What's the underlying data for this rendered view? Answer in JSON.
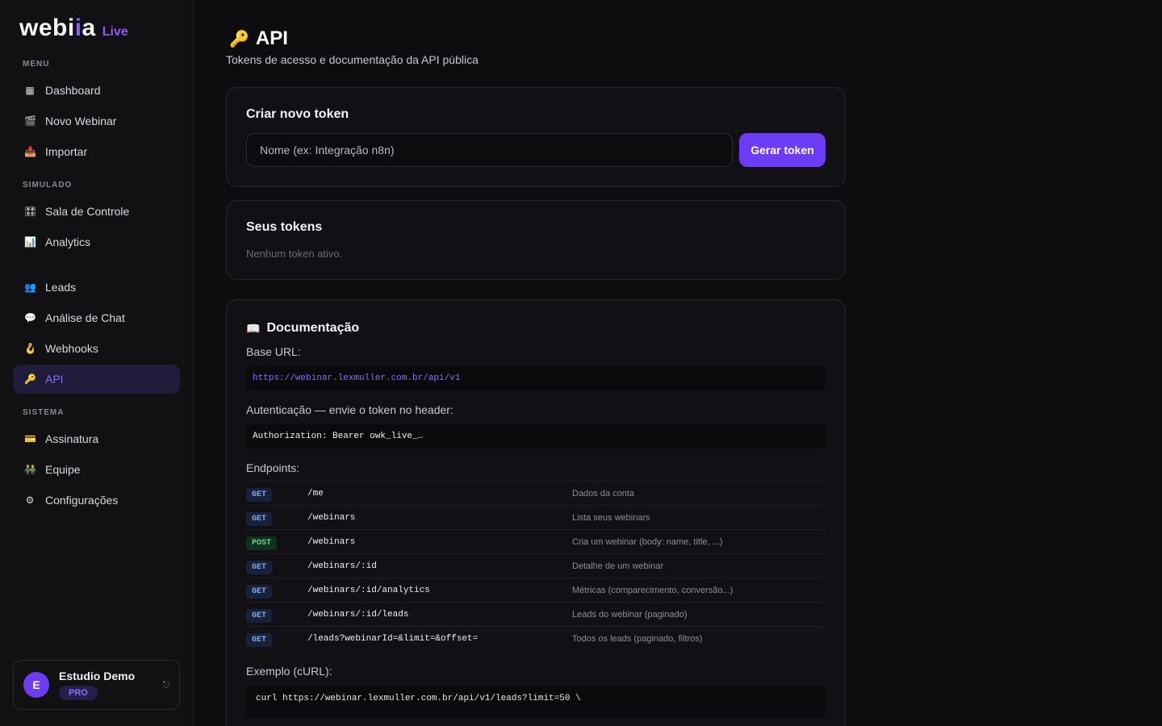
{
  "brand": {
    "logo_main": "webi",
    "logo_accent": "i",
    "logo_end": "a",
    "badge": "Live"
  },
  "sidebar": {
    "sections": {
      "menu": "MENU",
      "simulado": "SIMULADO",
      "sistema": "SISTEMA"
    },
    "items": [
      {
        "label": "Dashboard",
        "icon": "▦"
      },
      {
        "label": "Novo Webinar",
        "icon": "🎬"
      },
      {
        "label": "Importar",
        "icon": "📥"
      },
      {
        "label": "Sala de Controle",
        "icon": "🎛"
      },
      {
        "label": "Analytics",
        "icon": "📊"
      },
      {
        "label": "Leads",
        "icon": "👥"
      },
      {
        "label": "Análise de Chat",
        "icon": "💬"
      },
      {
        "label": "Webhooks",
        "icon": "🪝"
      },
      {
        "label": "API",
        "icon": "🔑"
      },
      {
        "label": "Assinatura",
        "icon": "💳"
      },
      {
        "label": "Equipe",
        "icon": "👬"
      },
      {
        "label": "Configurações",
        "icon": "⚙"
      }
    ],
    "user": {
      "initial": "E",
      "name": "Estudio Demo",
      "plan": "PRO",
      "logout_icon": "⎋"
    }
  },
  "page": {
    "title_icon": "🔑",
    "title": "API",
    "subtitle": "Tokens de acesso e documentação da API pública"
  },
  "create_token": {
    "title": "Criar novo token",
    "placeholder": "Nome (ex: Integração n8n)",
    "button": "Gerar token"
  },
  "tokens": {
    "title": "Seus tokens",
    "empty": "Nenhum token ativo."
  },
  "docs": {
    "title_icon": "📖",
    "title": "Documentação",
    "base_url_label": "Base URL:",
    "base_url": "https://webinar.lexmuller.com.br/api/v1",
    "auth_label": "Autenticação — envie o token no header:",
    "auth_header": "Authorization: Bearer owk_live_…",
    "endpoints_label": "Endpoints:",
    "endpoints": [
      {
        "method": "GET",
        "path": "/me",
        "desc": "Dados da conta"
      },
      {
        "method": "GET",
        "path": "/webinars",
        "desc": "Lista seus webinars"
      },
      {
        "method": "POST",
        "path": "/webinars",
        "desc": "Cria um webinar (body: name, title, ...)"
      },
      {
        "method": "GET",
        "path": "/webinars/:id",
        "desc": "Detalhe de um webinar"
      },
      {
        "method": "GET",
        "path": "/webinars/:id/analytics",
        "desc": "Métricas (comparecimento, conversão...)"
      },
      {
        "method": "GET",
        "path": "/webinars/:id/leads",
        "desc": "Leads do webinar (paginado)"
      },
      {
        "method": "GET",
        "path": "/leads?webinarId=&limit=&offset=",
        "desc": "Todos os leads (paginado, filtros)"
      }
    ],
    "example_label": "Exemplo (cURL):",
    "curl": "curl https://webinar.lexmuller.com.br/api/v1/leads?limit=50 \\"
  }
}
